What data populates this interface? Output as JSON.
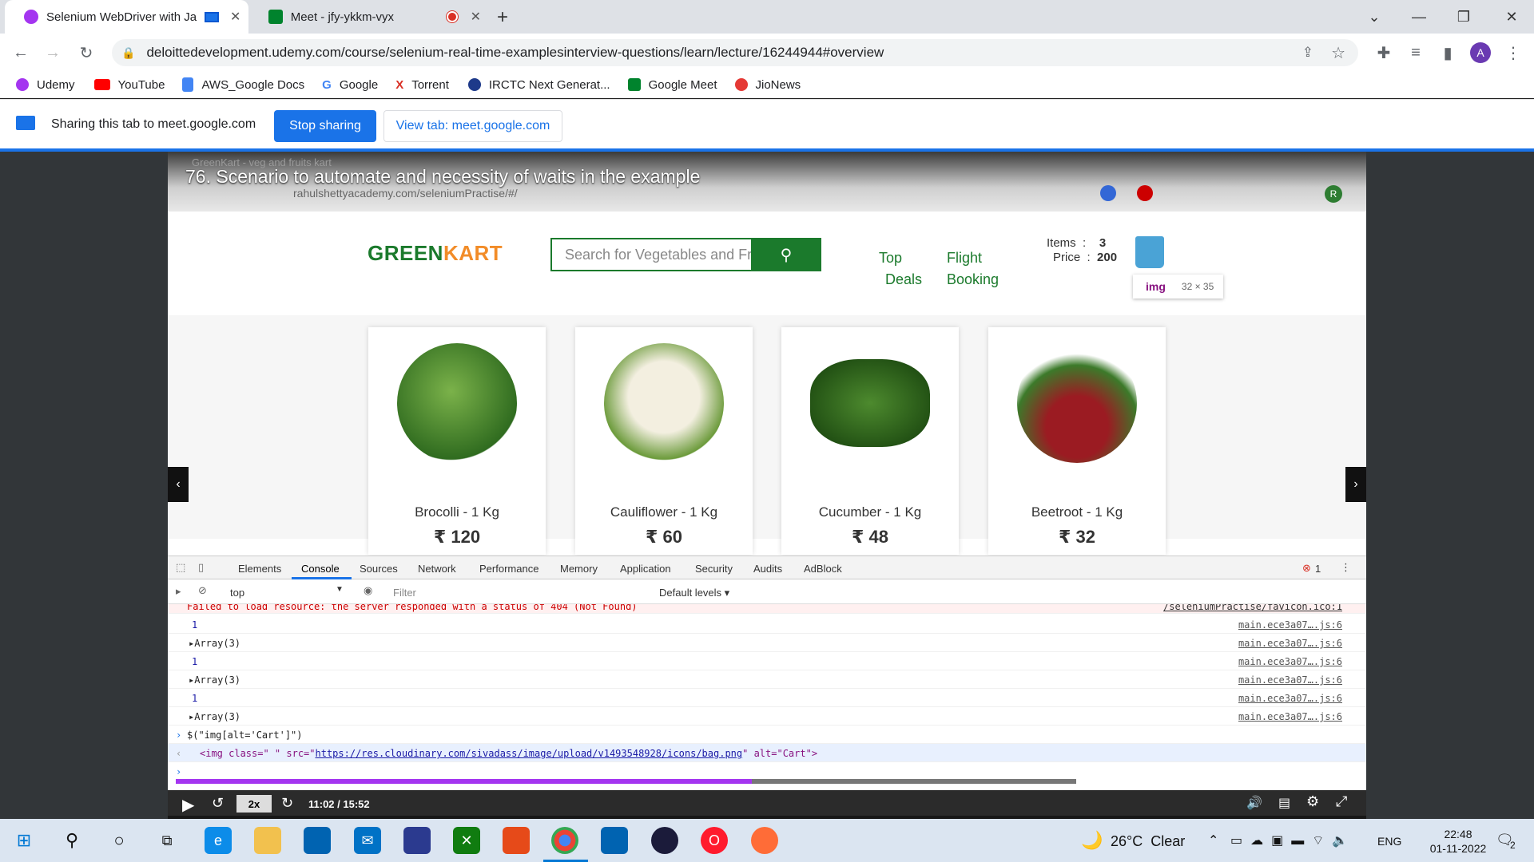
{
  "browser": {
    "tabs": [
      {
        "title": "Selenium WebDriver with Ja",
        "active": true
      },
      {
        "title": "Meet - jfy-ykkm-vyx",
        "active": false
      }
    ],
    "url": "deloittedevelopment.udemy.com/course/selenium-real-time-examplesinterview-questions/learn/lecture/16244944#overview",
    "profile_initial": "A",
    "bookmarks": [
      "Udemy",
      "YouTube",
      "AWS_Google Docs",
      "Google",
      "Torrent",
      "IRCTC Next Generat...",
      "Google Meet",
      "JioNews"
    ]
  },
  "sharebar": {
    "message": "Sharing this tab to meet.google.com",
    "stop_label": "Stop sharing",
    "view_label": "View tab: meet.google.com"
  },
  "video": {
    "lecture_title": "76. Scenario to automate and necessity of waits in the example",
    "inner_tab": "GreenKart - veg and fruits kart",
    "inner_url": "rahulshettyacademy.com/seleniumPractise/#/",
    "inner_profile": "R",
    "logo_green": "GREEN",
    "logo_kart": "KART",
    "search_placeholder": "Search for Vegetables and Fruits",
    "nav": {
      "top_deals_1": "Top",
      "top_deals_2": "Deals",
      "flight_1": "Flight",
      "flight_2": "Booking"
    },
    "cart": {
      "items_label": "Items",
      "items_value": "3",
      "price_label": "Price",
      "price_value": "200"
    },
    "tooltip": {
      "tag": "img",
      "size": "32 × 35"
    },
    "products": [
      {
        "name": "Brocolli - 1 Kg",
        "price": "₹ 120"
      },
      {
        "name": "Cauliflower - 1 Kg",
        "price": "₹ 60"
      },
      {
        "name": "Cucumber - 1 Kg",
        "price": "₹ 48"
      },
      {
        "name": "Beetroot - 1 Kg",
        "price": "₹ 32"
      }
    ],
    "devtools": {
      "tabs": [
        "Elements",
        "Console",
        "Sources",
        "Network",
        "Performance",
        "Memory",
        "Application",
        "Security",
        "Audits",
        "AdBlock"
      ],
      "active_tab": "Console",
      "error_count": "1",
      "context": "top",
      "filter_placeholder": "Filter",
      "levels": "Default levels ▾",
      "error_line": "Failed to load resource: the server responded with a status of 404 (Not Found)",
      "error_src": "/seleniumPractise/favicon.ico:1",
      "log_rows": [
        {
          "text": "1",
          "src": "main.ece3a07….js:6"
        },
        {
          "text": "▸Array(3)",
          "src": "main.ece3a07….js:6"
        },
        {
          "text": "1",
          "src": "main.ece3a07….js:6"
        },
        {
          "text": "▸Array(3)",
          "src": "main.ece3a07….js:6"
        },
        {
          "text": "1",
          "src": "main.ece3a07….js:6"
        },
        {
          "text": "▸Array(3)",
          "src": "main.ece3a07….js:6"
        }
      ],
      "command": "$(\"img[alt='Cart']\")",
      "result_prefix": "<img class=\" \" src=\"",
      "result_link": "https://res.cloudinary.com/sivadass/image/upload/v1493548928/icons/bag.png",
      "result_suffix": "\" alt=\"Cart\">"
    },
    "player": {
      "speed": "2x",
      "time": "11:02 / 15:52",
      "progress": 0.64
    }
  },
  "taskbar": {
    "weather": "26°C  Clear",
    "language": "ENG",
    "time": "22:48",
    "date": "01-11-2022",
    "notif_count": "2"
  }
}
